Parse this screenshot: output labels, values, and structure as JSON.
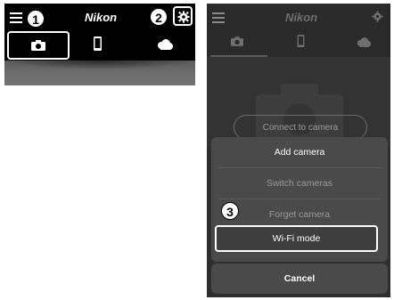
{
  "left_screen": {
    "logo": "Nikon",
    "callout_1": "1",
    "callout_2": "2",
    "tabs": [
      "camera-icon",
      "phone-icon",
      "cloud-icon"
    ],
    "active_tab": "camera-icon"
  },
  "right_screen": {
    "logo": "Nikon",
    "tabs": [
      "camera-icon",
      "phone-icon",
      "cloud-icon"
    ],
    "connect_button": "Connect to camera",
    "sheet": {
      "add_camera": "Add camera",
      "switch_cameras": "Switch cameras",
      "forget_camera": "Forget camera",
      "wifi_mode": "Wi-Fi mode",
      "cancel": "Cancel"
    },
    "callout_3": "3"
  },
  "colors": {
    "bar_bg": "#000000",
    "right_bg": "#2e2e2e",
    "sheet_bg": "#4a4a4a",
    "text_enabled": "#ffffff",
    "text_disabled": "#9a9a9a"
  }
}
